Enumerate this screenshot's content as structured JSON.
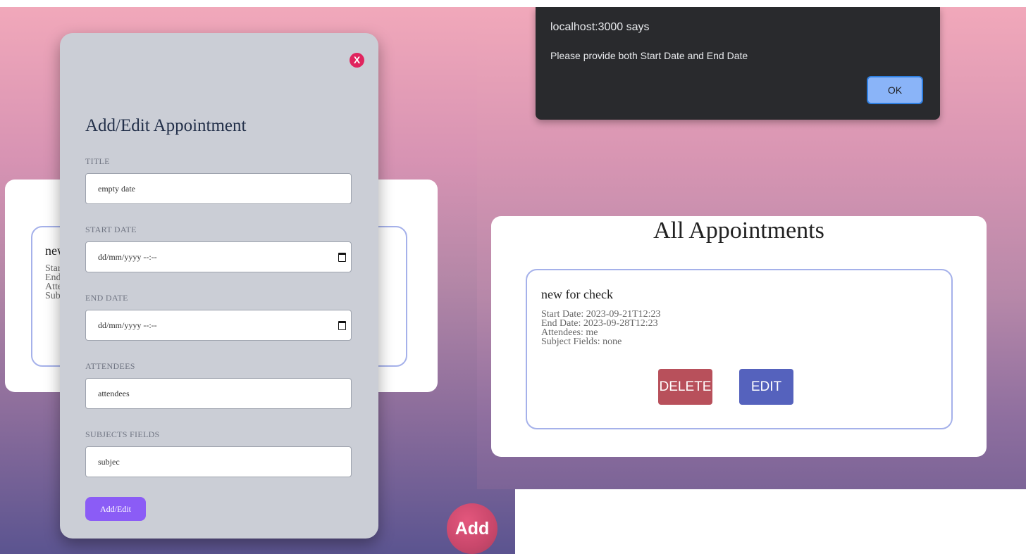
{
  "background_appointment": {
    "title": "new",
    "lines": [
      "Star",
      "End",
      "Atte",
      "Sub"
    ]
  },
  "modal": {
    "close_label": "X",
    "title": "Add/Edit Appointment",
    "fields": {
      "title": {
        "label": "TITLE",
        "value": "empty date"
      },
      "start_date": {
        "label": "START DATE",
        "value": "dd/mm/yyyy --:--"
      },
      "end_date": {
        "label": "END DATE",
        "value": "dd/mm/yyyy --:--"
      },
      "attendees": {
        "label": "ATTENDEES",
        "value": "attendees"
      },
      "subjects": {
        "label": "SUBJECTS FIELDS",
        "value": "subjec"
      }
    },
    "submit_label": "Add/Edit"
  },
  "fab": {
    "label": "Add"
  },
  "alert": {
    "title": "localhost:3000 says",
    "message": "Please provide both Start Date and End Date",
    "ok_label": "OK"
  },
  "list": {
    "heading": "All Appointments",
    "appointment": {
      "title": "new for check",
      "start": "Start Date: 2023-09-21T12:23",
      "end": "End Date: 2023-09-28T12:23",
      "attendees": "Attendees: me",
      "subjects": "Subject Fields: none"
    },
    "delete_label": "DELETE",
    "edit_label": "EDIT"
  },
  "colors": {
    "accent_purple": "#8b5cf6",
    "delete_red": "#b8505b",
    "edit_blue": "#5562bd",
    "close_pink": "#e0245e"
  }
}
